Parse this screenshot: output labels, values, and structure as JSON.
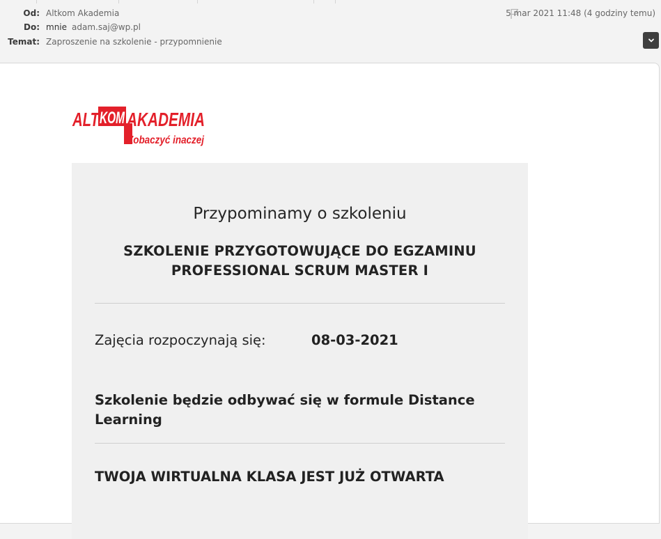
{
  "header": {
    "from_label": "Od:",
    "from_value": "Altkom Akademia",
    "to_label": "Do:",
    "to_name": "mnie",
    "to_email": "adam.saj@wp.pl",
    "subject_label": "Temat:",
    "subject_value": "Zaproszenie na szkolenie - przypomnienie",
    "date": "5 mar 2021 11:48 (4 godziny temu)",
    "flag_icon": "flag-icon",
    "expand_icon": "chevron-down-icon"
  },
  "logo": {
    "brand_left": "ALT",
    "brand_boxed": "KOM",
    "brand_right": "AKADEMIA",
    "tagline": "Zobaczyć inaczej",
    "color": "#e3202a"
  },
  "email": {
    "intro": "Przypominamy o szkoleniu",
    "course_title_line1": "SZKOLENIE PRZYGOTOWUJĄCE DO EGZAMINU",
    "course_title_line2": "PROFESSIONAL SCRUM MASTER I",
    "start_label": "Zajęcia rozpoczynają się:",
    "start_date": "08-03-2021",
    "format_text": "Szkolenie będzie odbywać się w formule Distance Learning",
    "classroom_text": "TWOJA WIRTUALNA KLASA JEST JUŻ OTWARTA"
  }
}
